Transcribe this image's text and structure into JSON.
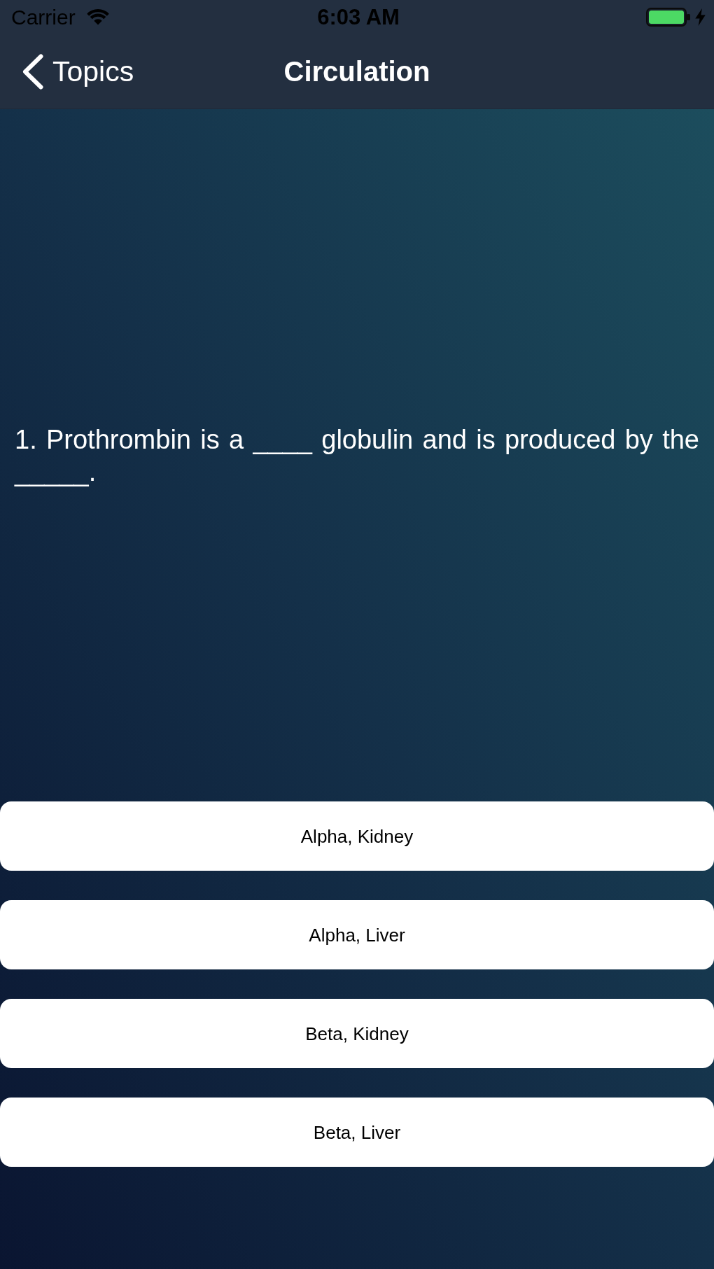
{
  "status_bar": {
    "carrier": "Carrier",
    "time": "6:03 AM"
  },
  "nav_bar": {
    "back_label": "Topics",
    "title": "Circulation"
  },
  "question": {
    "text": "1. Prothrombin is a ____ globulin and is produced by the _____."
  },
  "answers": [
    "Alpha, Kidney",
    "Alpha, Liver",
    "Beta, Kidney",
    "Beta, Liver"
  ]
}
